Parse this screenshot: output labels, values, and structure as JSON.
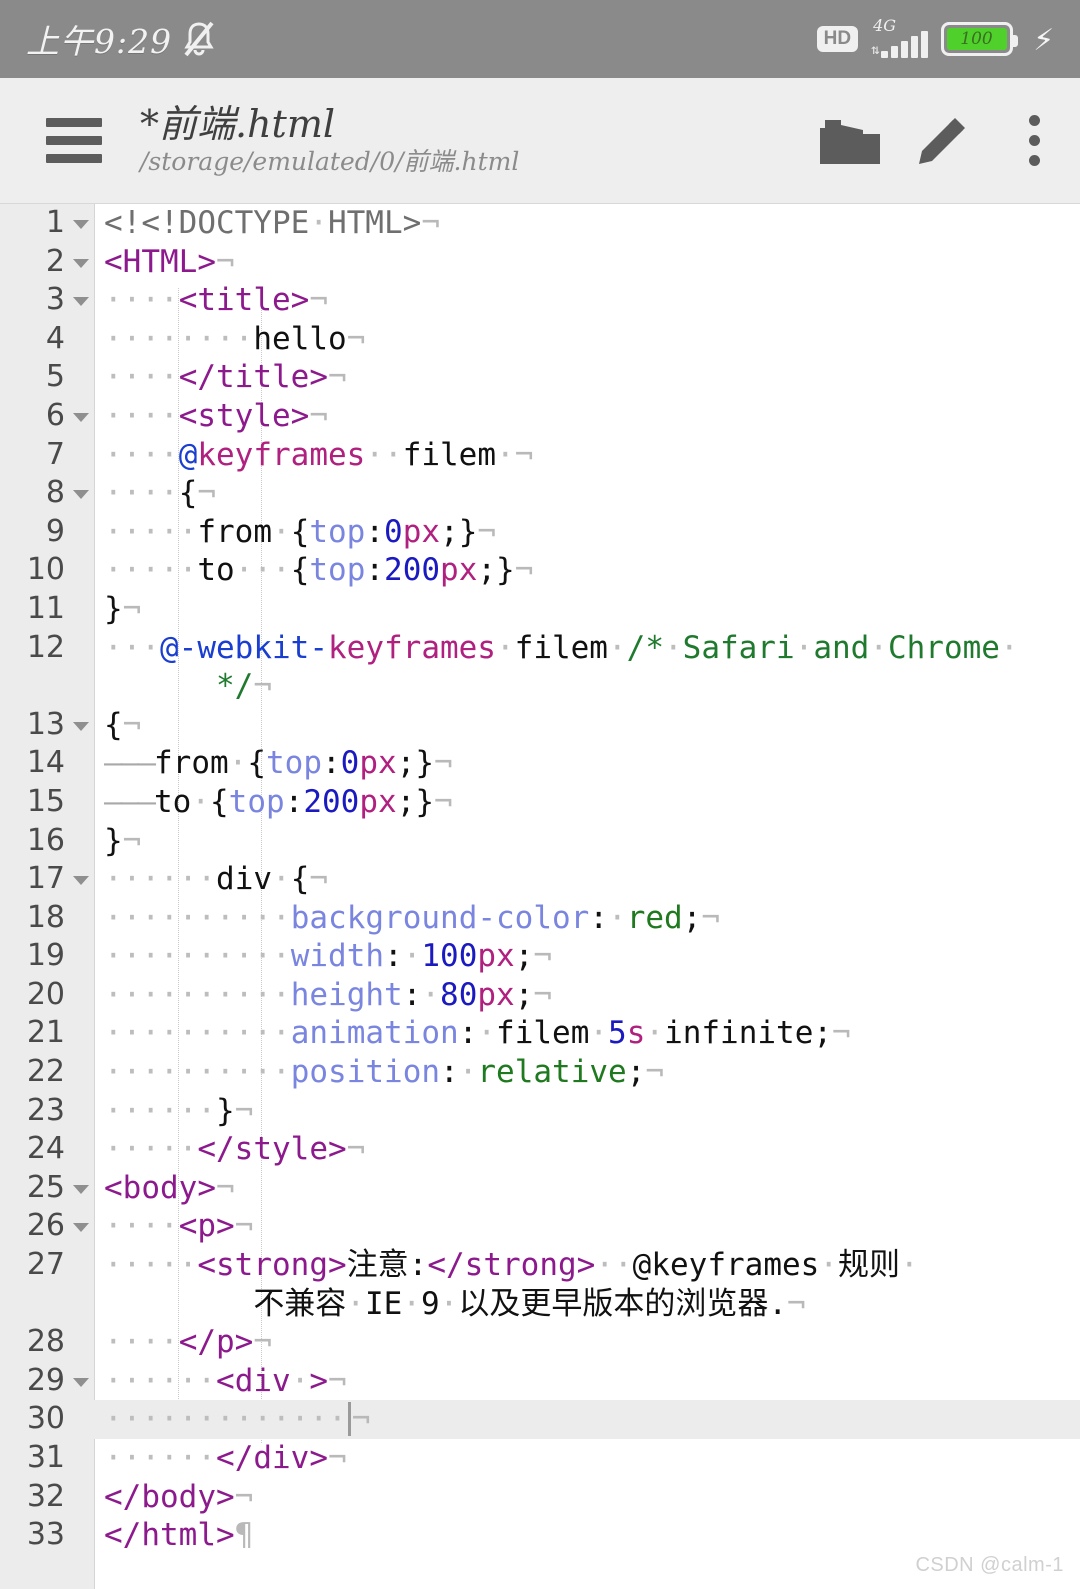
{
  "statusbar": {
    "time": "上午9:29",
    "bell_icon": "bell-muted-icon",
    "hd_label": "HD",
    "network_label": "4G",
    "battery_level": "100",
    "battery_color": "#4fd02b",
    "charging_icon": "charging-bolt-icon",
    "bg_color": "#8a8a8a"
  },
  "toolbar": {
    "menu_icon": "hamburger-menu-icon",
    "file_title": "*前端.html",
    "file_path": "/storage/emulated/0/前端.html",
    "open_icon": "open-folder-icon",
    "edit_icon": "pencil-edit-icon",
    "overflow_icon": "kebab-menu-icon",
    "bg_color": "#eeeeee"
  },
  "editor": {
    "gutter_bg": "#ececec",
    "active_line": 30,
    "lines": [
      {
        "n": "1",
        "fold": true
      },
      {
        "n": "2",
        "fold": true
      },
      {
        "n": "3",
        "fold": true
      },
      {
        "n": "4",
        "fold": false
      },
      {
        "n": "5",
        "fold": false
      },
      {
        "n": "6",
        "fold": true
      },
      {
        "n": "7",
        "fold": false
      },
      {
        "n": "8",
        "fold": true
      },
      {
        "n": "9",
        "fold": false
      },
      {
        "n": "10",
        "fold": false
      },
      {
        "n": "11",
        "fold": false
      },
      {
        "n": "12",
        "fold": false
      },
      {
        "n": "13",
        "fold": true
      },
      {
        "n": "14",
        "fold": false
      },
      {
        "n": "15",
        "fold": false
      },
      {
        "n": "16",
        "fold": false
      },
      {
        "n": "17",
        "fold": true
      },
      {
        "n": "18",
        "fold": false
      },
      {
        "n": "19",
        "fold": false
      },
      {
        "n": "20",
        "fold": false
      },
      {
        "n": "21",
        "fold": false
      },
      {
        "n": "22",
        "fold": false
      },
      {
        "n": "23",
        "fold": false
      },
      {
        "n": "24",
        "fold": false
      },
      {
        "n": "25",
        "fold": true
      },
      {
        "n": "26",
        "fold": true
      },
      {
        "n": "27",
        "fold": false
      },
      {
        "n": "28",
        "fold": false
      },
      {
        "n": "29",
        "fold": true
      },
      {
        "n": "30",
        "fold": false
      },
      {
        "n": "31",
        "fold": false
      },
      {
        "n": "32",
        "fold": false
      },
      {
        "n": "33",
        "fold": false
      }
    ],
    "code_text": [
      "<!<!DOCTYPE HTML>",
      "<HTML>",
      "    <title>",
      "        hello",
      "    </title>",
      "    <style>",
      "    @keyframes  filem ",
      "    {",
      "     from {top:0px;}",
      "     to   {top:200px;}",
      "}",
      "  @-webkit-keyframes filem /* Safari and Chrome */",
      "{",
      "from {top:0px;}",
      "to {top:200px;}",
      "}",
      "    div {",
      "        background-color: red;",
      "        width: 100px;",
      "        height: 80px;",
      "        animation: filem 5s infinite;",
      "        position: relative;",
      "    }",
      "    </style>",
      "<body>",
      "    <p>",
      "     <strong>注意:</strong>  @keyframes 规则 不兼容 IE 9 以及更早版本的浏览器.",
      "    </p>",
      "      <div >",
      "          ",
      "      </div>",
      "</body>",
      "</html>"
    ]
  },
  "watermark": {
    "text": "CSDN @calm-1"
  }
}
